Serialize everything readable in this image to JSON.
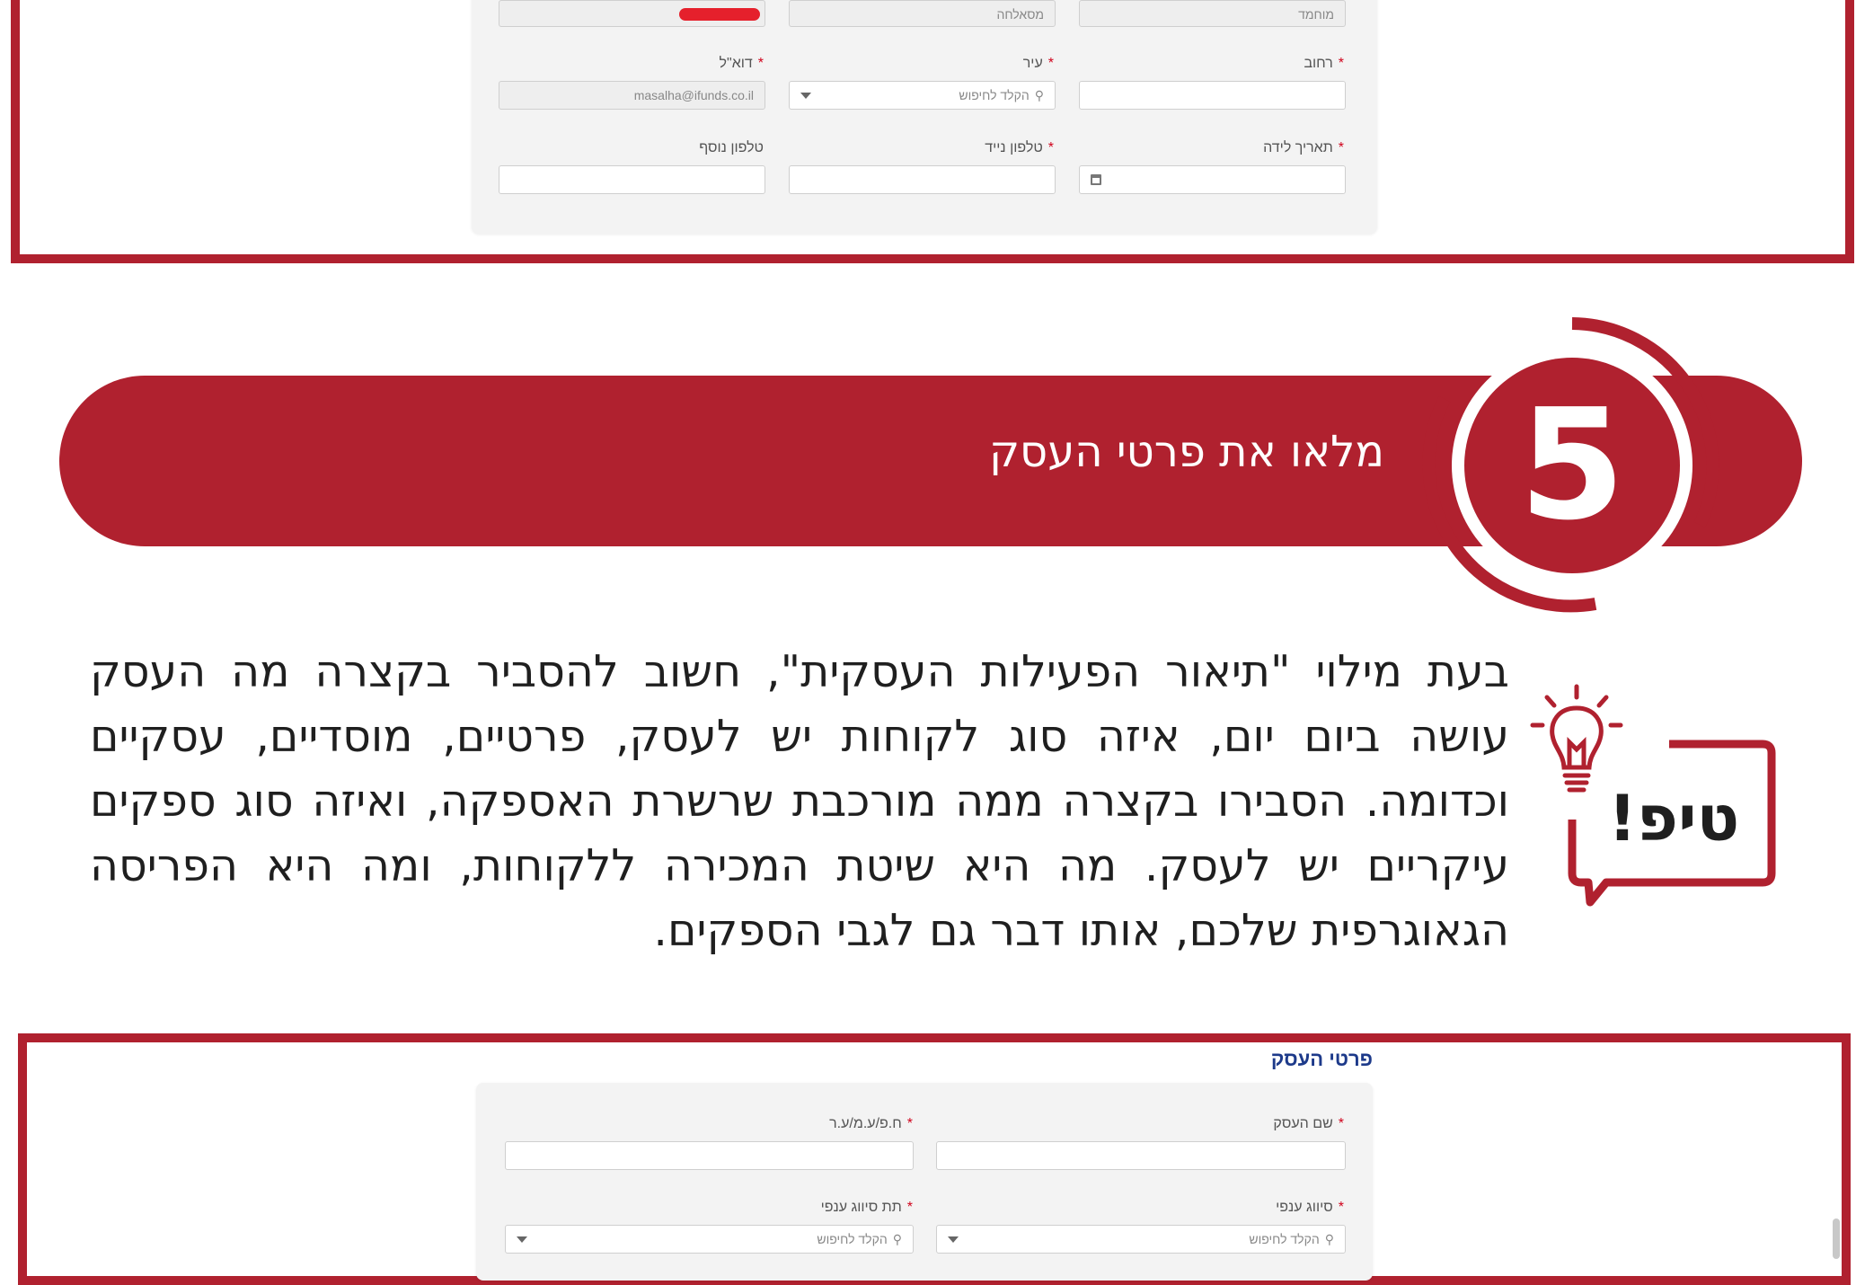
{
  "top_form": {
    "row1": {
      "right_value": "מוחמד",
      "middle_value": "מסאלחה"
    },
    "row2": {
      "right_label": "רחוב",
      "middle_label": "עיר",
      "middle_placeholder": "הקלד לחיפוש",
      "left_label": "דוא\"ל",
      "left_value": "masalha@ifunds.co.il"
    },
    "row3": {
      "right_label": "תאריך לידה",
      "middle_label": "טלפון נייד",
      "left_label": "טלפון נוסף"
    }
  },
  "step": {
    "number": "5",
    "title": "מלאו את פרטי העסק"
  },
  "tip": {
    "label": "טיפ!",
    "text": "בעת מילוי \"תיאור הפעילות העסקית\", חשוב להסביר בקצרה מה העסק עושה ביום יום, איזה סוג לקוחות יש לעסק, פרטיים, מוסדיים, עסקיים וכדומה. הסבירו בקצרה ממה מורכבת שרשרת האספקה, ואיזה סוג ספקים עיקריים יש לעסק. מה היא שיטת המכירה ללקוחות, ומה היא הפריסה הגאוגרפית שלכם, אותו דבר גם לגבי הספקים."
  },
  "business_form": {
    "title": "פרטי העסק",
    "row1": {
      "right_label": "שם העסק",
      "left_label": "ח.פ/ע.מ/ע.ר"
    },
    "row2": {
      "right_label": "סיווג ענפי",
      "left_label": "תת סיווג ענפי",
      "placeholder": "הקלד לחיפוש"
    }
  },
  "colors": {
    "brand_red": "#b0212f",
    "title_blue": "#1d3a8a",
    "required_red": "#d0021b"
  },
  "icons": [
    "search-icon",
    "chevron-down-icon",
    "calendar-icon",
    "lightbulb-icon",
    "speech-bubble-icon"
  ]
}
